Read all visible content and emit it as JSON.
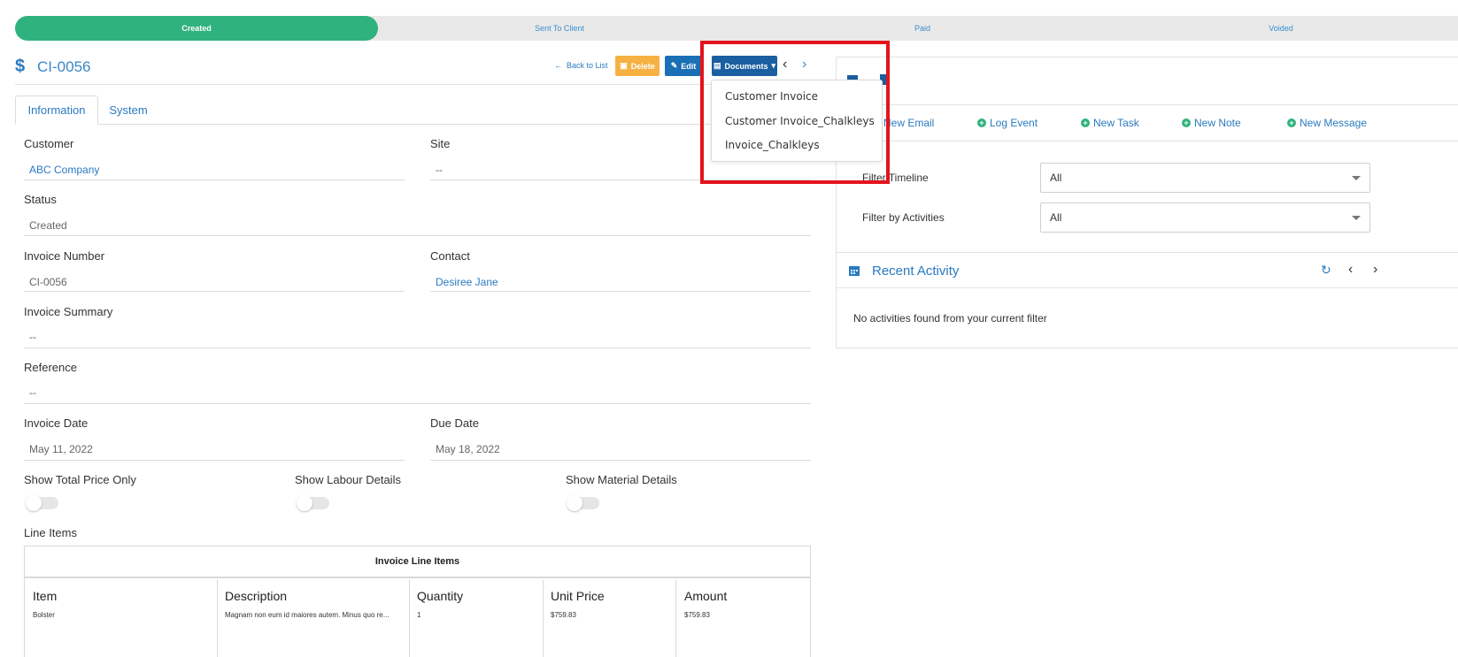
{
  "steps": [
    "Created",
    "Sent To Client",
    "Paid",
    "Voided"
  ],
  "header": {
    "title": "CI-0056",
    "back_label": "Back to List",
    "delete_label": "Delete",
    "edit_label": "Edit",
    "documents_label": "Documents"
  },
  "documents_menu": [
    "Customer Invoice",
    "Customer Invoice_Chalkleys",
    "Invoice_Chalkleys"
  ],
  "tabs": [
    "Information",
    "System"
  ],
  "fields": {
    "customer": {
      "label": "Customer",
      "value": "ABC Company"
    },
    "site": {
      "label": "Site",
      "value": "--"
    },
    "status": {
      "label": "Status",
      "value": "Created"
    },
    "invoice_number": {
      "label": "Invoice Number",
      "value": "CI-0056"
    },
    "contact": {
      "label": "Contact",
      "value": "Desiree Jane"
    },
    "invoice_summary": {
      "label": "Invoice Summary",
      "value": "--"
    },
    "reference": {
      "label": "Reference",
      "value": "--"
    },
    "invoice_date": {
      "label": "Invoice Date",
      "value": "May 11, 2022"
    },
    "due_date": {
      "label": "Due Date",
      "value": "May 18, 2022"
    }
  },
  "toggles": [
    "Show Total Price Only",
    "Show Labour Details",
    "Show Material Details"
  ],
  "line_items": {
    "section_label": "Line Items",
    "caption": "Invoice Line Items",
    "columns": [
      "Item",
      "Description",
      "Quantity",
      "Unit Price",
      "Amount"
    ],
    "rows": [
      [
        "Bolster",
        "Magnam non eum id maiores autem. Minus quo re...",
        "1",
        "$759.83",
        "$759.83"
      ]
    ]
  },
  "activity": {
    "actions": [
      "New Email",
      "Log Event",
      "New Task",
      "New Note",
      "New Message"
    ],
    "filter_timeline_label": "Filter Timeline",
    "filter_timeline_value": "All",
    "filter_activities_label": "Filter by Activities",
    "filter_activities_value": "All",
    "recent_title": "Recent Activity",
    "empty_message": "No activities found from your current filter"
  },
  "colors": {
    "primary": "#2a7ac0",
    "success": "#2fb27d",
    "warning": "#f6b142",
    "highlight": "#e3141c"
  }
}
